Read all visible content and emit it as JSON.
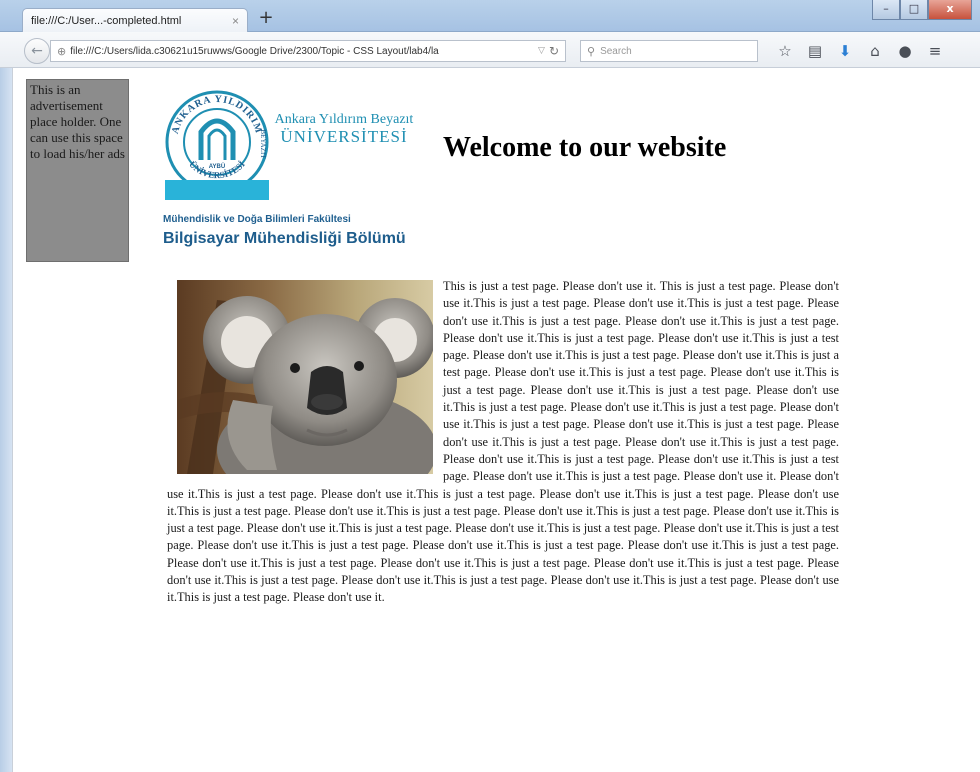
{
  "browser": {
    "tab_title": "file:///C:/User...-completed.html",
    "tab_close": "×",
    "new_tab": "+",
    "url": "file:///C:/Users/lida.c30621u15ruwws/Google Drive/2300/Topic - CSS Layout/lab4/la",
    "search_placeholder": "Search",
    "controls": {
      "minimize": "–",
      "maximize": "□",
      "close": "x"
    },
    "icons": [
      "back-icon",
      "site-info-icon",
      "reload-icon",
      "search-icon",
      "bookmark-star-icon",
      "reading-list-icon",
      "download-icon",
      "home-icon",
      "chat-icon",
      "menu-icon"
    ]
  },
  "page": {
    "ad_text": "This is an advertisement place holder. One can use this space to load his/her ads",
    "logo": {
      "ring_text_top": "ANKARA YILDIRIM",
      "ring_text_bottom": "ÜNİVERSİTESİ",
      "badge": "AYBÜ",
      "ring_text_side": "BEYAZIT"
    },
    "university_line1": "Ankara Yıldırım Beyazıt",
    "university_line2": "ÜNİVERSİTESİ",
    "faculty": "Mühendislik ve Doğa Bilimleri Fakültesi",
    "department": "Bilgisayar Mühendisliği Bölümü",
    "title": "Welcome to our website",
    "body_text": "This is just a test page. Please don't use it. This is just a test page. Please don't use it.This is just a test page. Please don't use it.This is just a test page. Please don't use it.This is just a test page. Please don't use it.This is just a test page. Please don't use it.This is just a test page. Please don't use it.This is just a test page. Please don't use it.This is just a test page. Please don't use it.This is just a test page. Please don't use it.This is just a test page. Please don't use it.This is just a test page. Please don't use it.This is just a test page. Please don't use it.This is just a test page. Please don't use it.This is just a test page. Please don't use it.This is just a test page. Please don't use it.This is just a test page. Please don't use it.This is just a test page. Please don't use it.This is just a test page. Please don't use it.This is just a test page. Please don't use it.This is just a test page. Please don't use it.This is just a test page. Please don't use it. Please don't use it.This is just a test page. Please don't use it.This is just a test page. Please don't use it.This is just a test page. Please don't use it.This is just a test page. Please don't use it.This is just a test page. Please don't use it.This is just a test page. Please don't use it.This is just a test page. Please don't use it.This is just a test page. Please don't use it.This is just a test page. Please don't use it.This is just a test page. Please don't use it.This is just a test page. Please don't use it.This is just a test page. Please don't use it.This is just a test page. Please don't use it.This is just a test page. Please don't use it.This is just a test page. Please don't use it.This is just a test page. Please don't use it.This is just a test page. Please don't use it.This is just a test page. Please don't use it.This is just a test page. Please don't use it.This is just a test page. Please don't use it."
  },
  "colors": {
    "brand_blue": "#1f8fb2",
    "dept_blue": "#1e5d8c",
    "ad_gray": "#8c8c8c"
  }
}
